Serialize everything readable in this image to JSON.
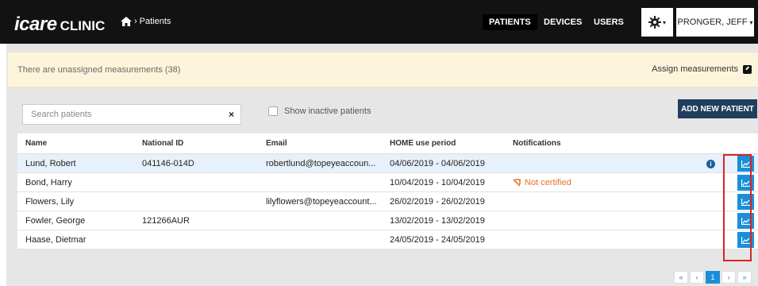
{
  "brand": {
    "logo_main": "icare",
    "logo_sub": "CLINIC"
  },
  "breadcrumb": {
    "separator": "›",
    "current": "Patients"
  },
  "nav": {
    "items": [
      {
        "label": "PATIENTS"
      },
      {
        "label": "DEVICES"
      },
      {
        "label": "USERS"
      }
    ],
    "user": "PRONGER, JEFF"
  },
  "alert": {
    "text": "There are unassigned measurements (38)",
    "link": "Assign measurements"
  },
  "search": {
    "placeholder": "Search patients",
    "clear": "×"
  },
  "filter": {
    "inactive_label": "Show inactive patients"
  },
  "add_button": "ADD NEW PATIENT",
  "table": {
    "headers": {
      "name": "Name",
      "national_id": "National ID",
      "email": "Email",
      "period": "HOME use period",
      "notifications": "Notifications"
    },
    "rows": [
      {
        "name": "Lund, Robert",
        "national_id": "041146-014D",
        "email": "robertlund@topeyeaccoun...",
        "period": "04/06/2019 - 04/06/2019",
        "notification": ""
      },
      {
        "name": "Bond, Harry",
        "national_id": "",
        "email": "",
        "period": "10/04/2019 - 10/04/2019",
        "notification": "Not certified"
      },
      {
        "name": "Flowers, Lily",
        "national_id": "",
        "email": "lilyflowers@topeyeaccount...",
        "period": "26/02/2019 - 26/02/2019",
        "notification": ""
      },
      {
        "name": "Fowler, George",
        "national_id": "121266AUR",
        "email": "",
        "period": "13/02/2019 - 13/02/2019",
        "notification": ""
      },
      {
        "name": "Haase, Dietmar",
        "national_id": "",
        "email": "",
        "period": "24/05/2019 - 24/05/2019",
        "notification": ""
      }
    ]
  },
  "pagination": {
    "first": "«",
    "prev": "‹",
    "current": "1",
    "next": "›",
    "last": "»"
  },
  "colors": {
    "accent": "#1a8fd8",
    "highlight": "#d9232a",
    "warn": "#e8712a",
    "topbar": "#121212",
    "add_button": "#1f3f5c"
  }
}
